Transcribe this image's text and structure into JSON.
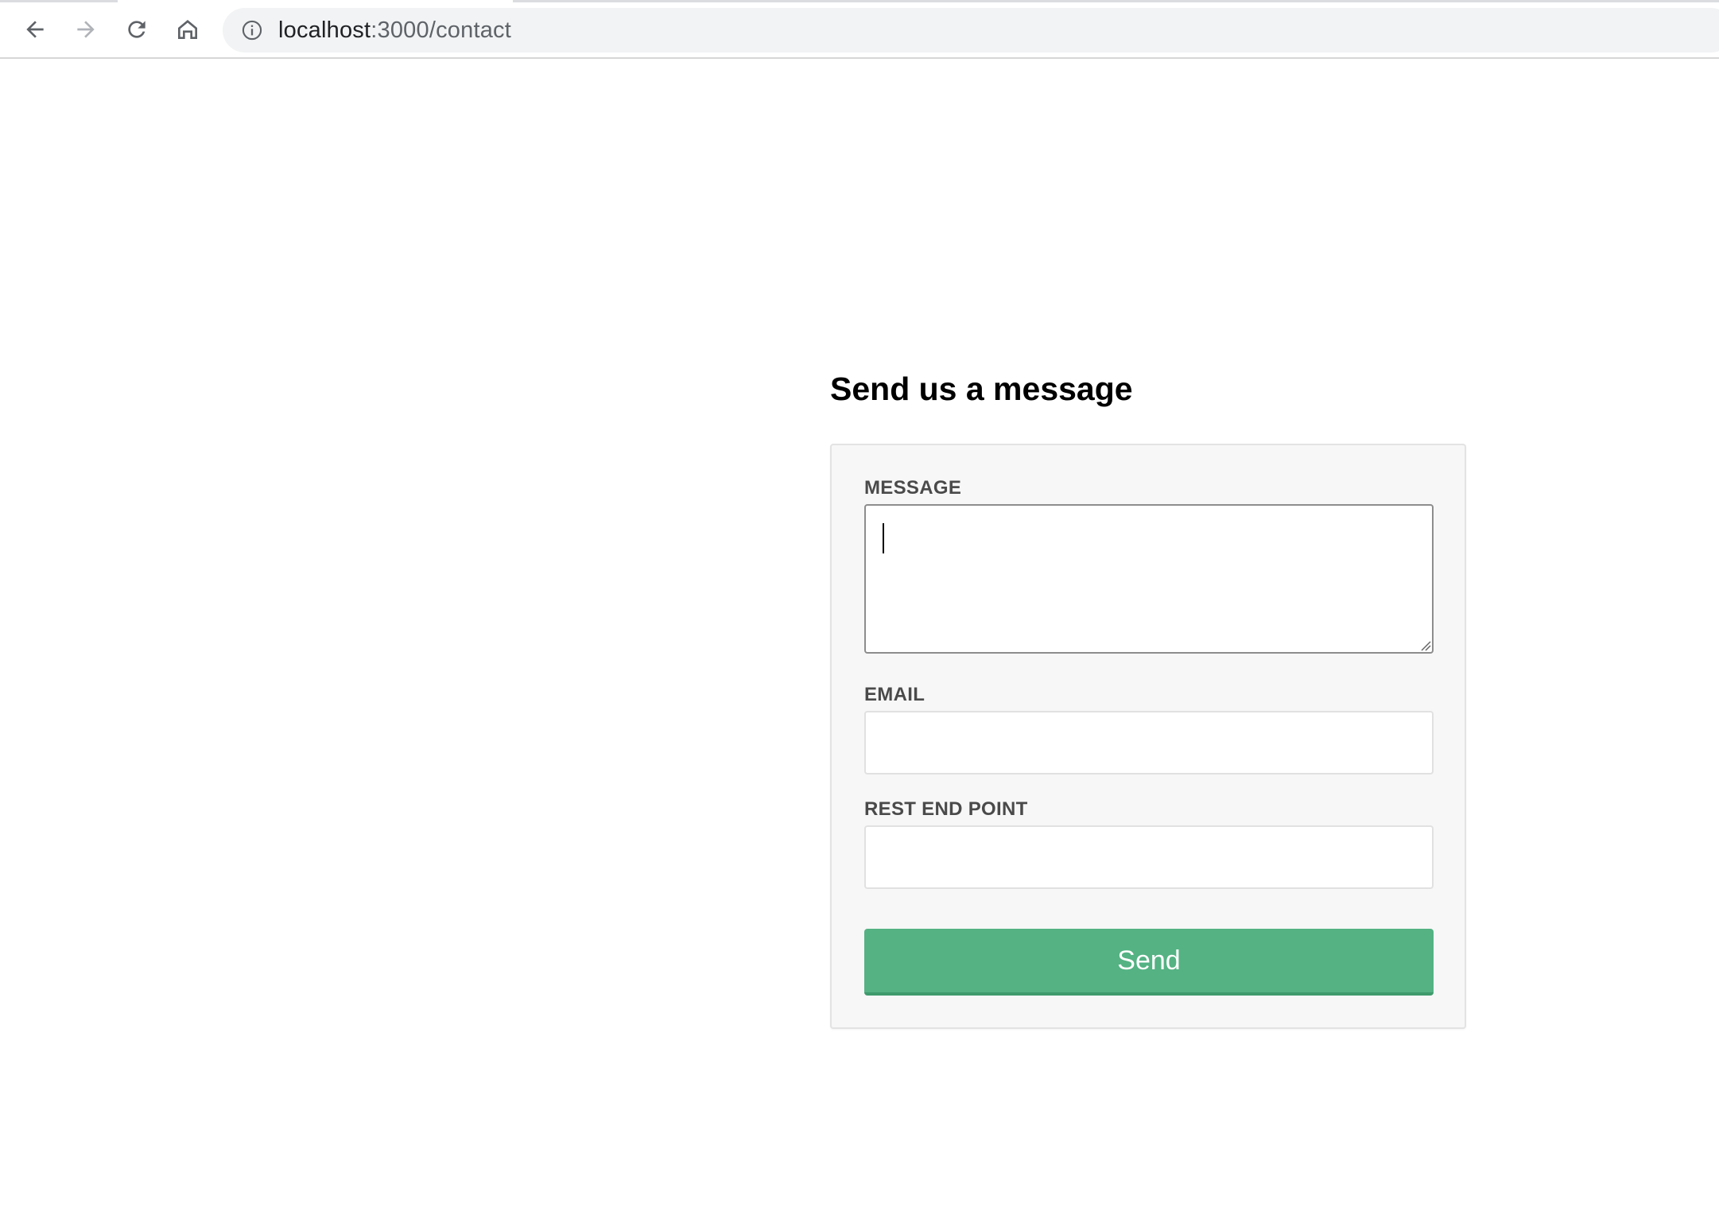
{
  "browser": {
    "url_host": "localhost",
    "url_path": ":3000/contact",
    "icons": {
      "back": "arrow-left-icon",
      "forward": "arrow-right-icon",
      "reload": "reload-icon",
      "home": "home-icon",
      "info": "info-icon"
    }
  },
  "page": {
    "title": "Send us a message"
  },
  "form": {
    "message_label": "MESSAGE",
    "message_value": "",
    "email_label": "EMAIL",
    "email_value": "",
    "endpoint_label": "REST END POINT",
    "endpoint_value": "",
    "send_label": "Send"
  },
  "colors": {
    "send_button": "#54b283",
    "card_background": "#f7f7f7"
  }
}
